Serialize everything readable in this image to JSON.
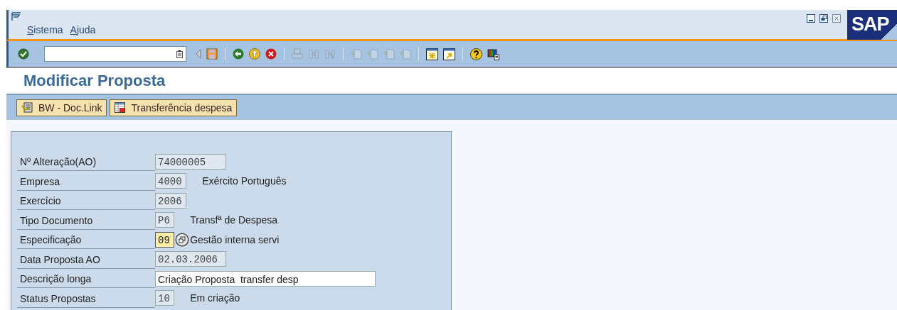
{
  "menu": [
    {
      "label": "Sistema"
    },
    {
      "label": "Ajuda"
    }
  ],
  "logo": "SAP",
  "title": "Modificar Proposta",
  "app_buttons": [
    {
      "label": "BW - Doc.Link",
      "kind": "doclink"
    },
    {
      "label": "Transferência despesa",
      "kind": "table"
    }
  ],
  "fields": [
    {
      "label": "Nº Alteração(AO)",
      "value": "74000005",
      "kind": "display",
      "value_help": false
    },
    {
      "label": "Empresa",
      "value": "4000",
      "kind": "display",
      "description": "Exército Português",
      "value_help": false
    },
    {
      "label": "Exercício",
      "value": "2006",
      "kind": "display",
      "value_help": false
    },
    {
      "label": "Tipo Documento",
      "value": "P6",
      "kind": "display",
      "description": "Transfª de Despesa",
      "value_help": false
    },
    {
      "label": "Especificação",
      "value": "09",
      "kind": "focused",
      "description": "Gestão interna servi",
      "value_help": true
    },
    {
      "label": "Data Proposta AO",
      "value": "02.03.2006",
      "kind": "display",
      "value_help": false
    },
    {
      "label": "Descrição longa",
      "value": "Criação Proposta  transfer desp",
      "kind": "input",
      "value_help": false
    },
    {
      "label": "Status Propostas",
      "value": "10",
      "kind": "display",
      "description": "Em criação",
      "value_help": false
    }
  ]
}
